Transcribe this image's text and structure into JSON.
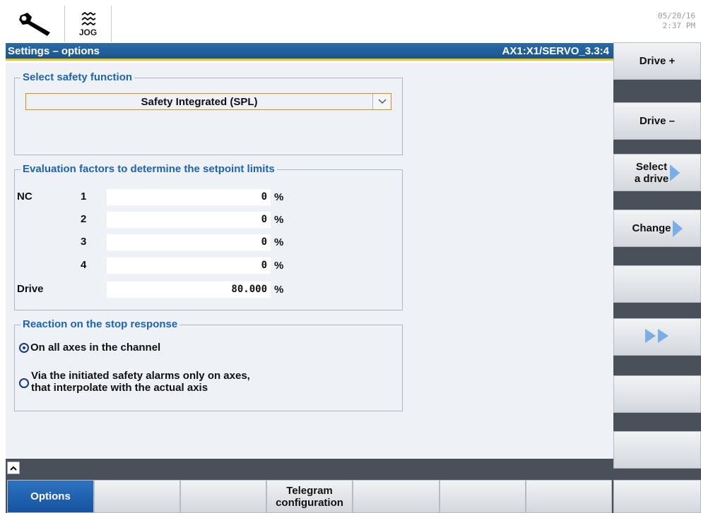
{
  "topbar": {
    "wrench_icon": "wrench-icon",
    "jog_label": "JOG",
    "jog_icon": "jog-wave-icon",
    "date": "05/20/16",
    "time": "2:37 PM"
  },
  "header": {
    "title": "Settings – options",
    "axis": "AX1:X1/SERVO_3.3:4"
  },
  "safety_group": {
    "title": "Select safety function",
    "selected": "Safety Integrated (SPL)"
  },
  "eval_group": {
    "title": "Evaluation factors to determine the setpoint limits",
    "nc_label": "NC",
    "drive_label": "Drive",
    "rows": [
      {
        "num": "1",
        "value": "0",
        "unit": "%"
      },
      {
        "num": "2",
        "value": "0",
        "unit": "%"
      },
      {
        "num": "3",
        "value": "0",
        "unit": "%"
      },
      {
        "num": "4",
        "value": "0",
        "unit": "%"
      }
    ],
    "drive_value": "80.000",
    "drive_unit": "%"
  },
  "stop_group": {
    "title": "Reaction on the stop response",
    "option1": "On all axes in the channel",
    "option2_line1": "Via the initiated safety alarms only on axes,",
    "option2_line2": "that interpolate with the actual axis",
    "selected_option": 1
  },
  "softkeys_right": {
    "drive_plus": "Drive +",
    "drive_minus": "Drive –",
    "select_drive_line1": "Select",
    "select_drive_line2": "a drive",
    "change": "Change"
  },
  "softkeys_bottom": {
    "options": "Options",
    "telegram_line1": "Telegram",
    "telegram_line2": "configuration"
  },
  "colors": {
    "header_blue": "#1b5590",
    "accent_yellow": "#f0c419",
    "group_title_blue": "#1e63b4",
    "active_key_blue": "#1553a0",
    "dropdown_border_orange": "#e08a17"
  }
}
